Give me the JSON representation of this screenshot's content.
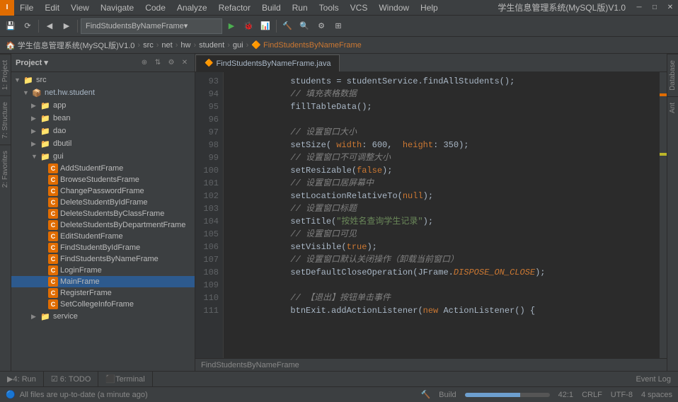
{
  "app": {
    "title": "学生信息管理系统(MySQL版)V1.0",
    "icon_label": "I"
  },
  "menu": {
    "items": [
      "File",
      "Edit",
      "View",
      "Navigate",
      "Code",
      "Analyze",
      "Refactor",
      "Build",
      "Run",
      "Tools",
      "VCS",
      "Window",
      "Help"
    ],
    "right_label": "学生信息管理系统(MySQL版)V1.0"
  },
  "toolbar": {
    "dropdown_text": "FindStudentsByNameFrame",
    "buttons": [
      "save",
      "sync",
      "undo",
      "redo",
      "back",
      "forward",
      "search",
      "build",
      "run",
      "debug",
      "profile"
    ]
  },
  "breadcrumb": {
    "items": [
      "学生信息管理系统(MySQL版)V1.0",
      "src",
      "net",
      "hw",
      "student",
      "gui",
      "FindStudentsByNameFrame"
    ]
  },
  "project_panel": {
    "title": "Project",
    "tree": [
      {
        "level": 0,
        "type": "folder",
        "label": "src",
        "expanded": true
      },
      {
        "level": 1,
        "type": "package",
        "label": "net.hw.student",
        "expanded": true
      },
      {
        "level": 2,
        "type": "folder",
        "label": "app",
        "expanded": false
      },
      {
        "level": 2,
        "type": "folder",
        "label": "bean",
        "expanded": false
      },
      {
        "level": 2,
        "type": "folder",
        "label": "dao",
        "expanded": false
      },
      {
        "level": 2,
        "type": "folder",
        "label": "dbutil",
        "expanded": false
      },
      {
        "level": 2,
        "type": "folder",
        "label": "gui",
        "expanded": true
      },
      {
        "level": 3,
        "type": "class",
        "label": "AddStudentFrame",
        "selected": false
      },
      {
        "level": 3,
        "type": "class",
        "label": "BrowseStudentsFrame",
        "selected": false
      },
      {
        "level": 3,
        "type": "class",
        "label": "ChangePasswordFrame",
        "selected": false
      },
      {
        "level": 3,
        "type": "class",
        "label": "DeleteStudentByIdFrame",
        "selected": false
      },
      {
        "level": 3,
        "type": "class",
        "label": "DeleteStudentsByClassFrame",
        "selected": false
      },
      {
        "level": 3,
        "type": "class",
        "label": "DeleteStudentsByDepartmentFrame",
        "selected": false
      },
      {
        "level": 3,
        "type": "class",
        "label": "EditStudentFrame",
        "selected": false
      },
      {
        "level": 3,
        "type": "class",
        "label": "FindStudentByIdFrame",
        "selected": false
      },
      {
        "level": 3,
        "type": "class",
        "label": "FindStudentsByNameFrame",
        "selected": false
      },
      {
        "level": 3,
        "type": "class",
        "label": "LoginFrame",
        "selected": false
      },
      {
        "level": 3,
        "type": "class",
        "label": "MainFrame",
        "selected": true
      },
      {
        "level": 3,
        "type": "class",
        "label": "RegisterFrame",
        "selected": false
      },
      {
        "level": 3,
        "type": "class",
        "label": "SetCollegeInfoFrame",
        "selected": false
      },
      {
        "level": 2,
        "type": "folder",
        "label": "service",
        "expanded": false
      }
    ]
  },
  "editor": {
    "tab_name": "FindStudentsByNameFrame.java",
    "footer_name": "FindStudentsByNameFrame",
    "lines": [
      {
        "num": 93,
        "code": [
          {
            "t": "plain",
            "v": "            students = studentService.findAllStudents();"
          }
        ]
      },
      {
        "num": 94,
        "code": [
          {
            "t": "chinese-comment",
            "v": "            // 填充表格数据"
          }
        ]
      },
      {
        "num": 95,
        "code": [
          {
            "t": "plain",
            "v": "            fillTableData();"
          }
        ]
      },
      {
        "num": 96,
        "code": [
          {
            "t": "plain",
            "v": ""
          }
        ]
      },
      {
        "num": 97,
        "code": [
          {
            "t": "chinese-comment",
            "v": "            // 设置窗口大小"
          }
        ]
      },
      {
        "num": 98,
        "code": [
          {
            "t": "plain",
            "v": "            setSize("
          },
          {
            "t": "kw",
            "v": "width"
          },
          {
            "t": "plain",
            "v": ": 600,  height: 350);"
          }
        ]
      },
      {
        "num": 99,
        "code": [
          {
            "t": "chinese-comment",
            "v": "            // 设置窗口不可调整大小"
          }
        ]
      },
      {
        "num": 100,
        "code": [
          {
            "t": "plain",
            "v": "            setResizable("
          },
          {
            "t": "kw",
            "v": "false"
          },
          {
            "t": "plain",
            "v": "};"
          }
        ]
      },
      {
        "num": 101,
        "code": [
          {
            "t": "chinese-comment",
            "v": "            // 设置窗口居屏幕中"
          }
        ]
      },
      {
        "num": 102,
        "code": [
          {
            "t": "plain",
            "v": "            setLocationRelativeTo("
          },
          {
            "t": "kw",
            "v": "null"
          },
          {
            "t": "plain",
            "v": "};"
          }
        ]
      },
      {
        "num": 103,
        "code": [
          {
            "t": "chinese-comment",
            "v": "            // 设置窗口标题"
          }
        ]
      },
      {
        "num": 104,
        "code": [
          {
            "t": "plain",
            "v": "            setTitle("
          },
          {
            "t": "str",
            "v": "\"按姓名查询学生记录\""
          },
          {
            "t": "plain",
            "v": "};"
          }
        ]
      },
      {
        "num": 105,
        "code": [
          {
            "t": "chinese-comment",
            "v": "            // 设置窗口可见"
          }
        ]
      },
      {
        "num": 106,
        "code": [
          {
            "t": "plain",
            "v": "            setVisible("
          },
          {
            "t": "kw",
            "v": "true"
          },
          {
            "t": "plain",
            "v": "};"
          }
        ]
      },
      {
        "num": 107,
        "code": [
          {
            "t": "chinese-comment",
            "v": "            // 设置窗口默认关闭操作（卸载当前窗口）"
          }
        ]
      },
      {
        "num": 108,
        "code": [
          {
            "t": "plain",
            "v": "            setDefaultCloseOperation(JFrame."
          },
          {
            "t": "kw-italic",
            "v": "DISPOSE_ON_CLOSE"
          },
          {
            "t": "plain",
            "v": "};"
          }
        ]
      },
      {
        "num": 109,
        "code": [
          {
            "t": "plain",
            "v": ""
          }
        ]
      },
      {
        "num": 110,
        "code": [
          {
            "t": "chinese-comment",
            "v": "            // 【退出】按钮单击事件"
          }
        ]
      },
      {
        "num": 111,
        "code": [
          {
            "t": "plain",
            "v": "            btnExit.addActionListener(new ActionListener() {"
          }
        ]
      }
    ]
  },
  "bottom_tabs": [
    {
      "id": "run",
      "label": "4: Run"
    },
    {
      "id": "todo",
      "label": "6: TODO"
    },
    {
      "id": "terminal",
      "label": "Terminal"
    }
  ],
  "status_bar": {
    "left_text": "All files are up-to-date (a minute ago)",
    "build_label": "Build",
    "position": "42:1",
    "crlf": "CRLF",
    "encoding": "UTF-8",
    "indent": "4 spaces",
    "progress": 65
  },
  "side_tabs_right": [
    "Database",
    "Ant"
  ],
  "side_tabs_left": [
    "1: Project",
    "2: Favorites",
    "7: Structure"
  ]
}
